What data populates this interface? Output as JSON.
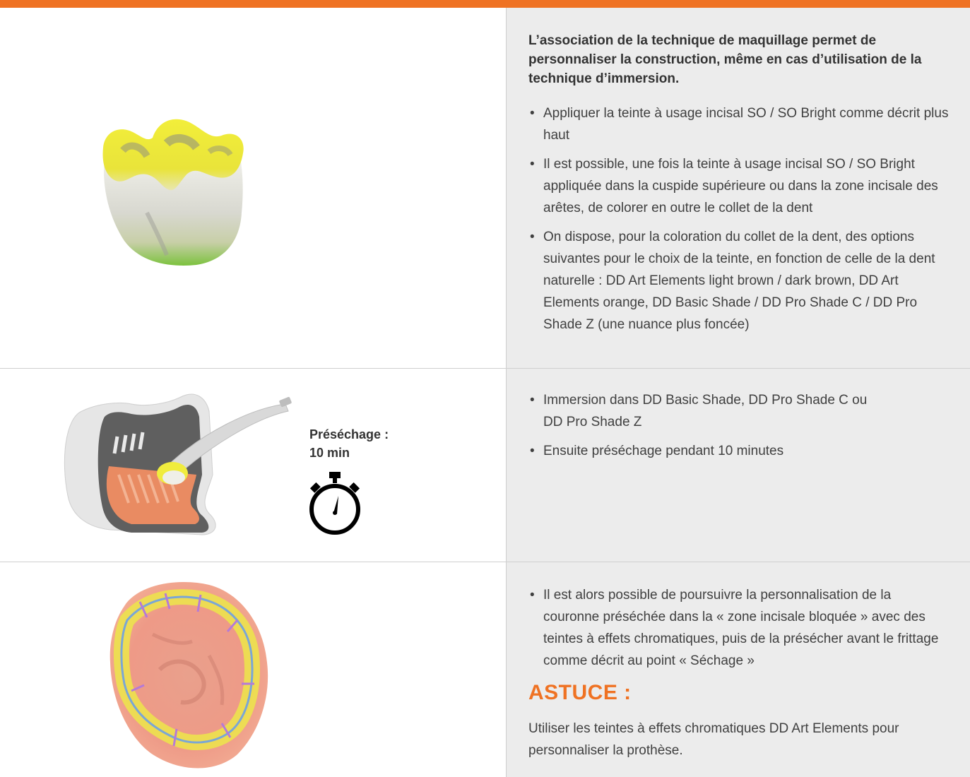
{
  "colors": {
    "accent": "#ef7223",
    "panel": "#ececec",
    "divider": "#cfcfcf"
  },
  "section1": {
    "lead": "L’association de la technique de maquillage permet de personnaliser la construction, même en cas d’utilisation de la technique d’immersion.",
    "bullets": [
      "Appliquer la teinte à usage incisal SO / SO Bright comme décrit plus haut",
      "Il est possible, une fois la teinte à usage incisal SO / SO Bright appliquée dans la cuspide supérieure ou dans la zone incisale des arêtes, de colorer en outre le collet de la dent",
      "On dispose, pour la coloration du collet de la dent, des options suivantes pour le choix de la teinte, en fonction de celle de la dent naturelle : DD Art Elements light brown / dark brown, DD Art Elements orange, DD Basic Shade / DD Pro Shade C / DD Pro Shade Z (une nuance plus foncée)"
    ],
    "illustration_icon": "tooth-crown-incisal-color"
  },
  "section2": {
    "predrying_label_line1": "Préséchage :",
    "predrying_label_line2": "10 min",
    "timer_icon": "stopwatch-icon",
    "illustration_icon": "immersion-container-tweezers",
    "bullets": [
      "Immersion dans DD Basic Shade, DD Pro Shade C ou DD Pro Shade Z",
      "Ensuite préséchage pendant 10 minutes"
    ]
  },
  "section3": {
    "illustration_icon": "tooth-occlusal-effect-colors",
    "bullets": [
      "Il est alors possible de poursuivre la personnalisation de la couronne préséchée dans la « zone incisale bloquée » avec des teintes à effets chromatiques, puis de la présécher avant le frittage comme décrit au point « Séchage »"
    ],
    "tip_title": "ASTUCE :",
    "tip_text": "Utiliser les teintes à effets chromatiques DD Art Elements pour personnaliser la prothèse."
  }
}
